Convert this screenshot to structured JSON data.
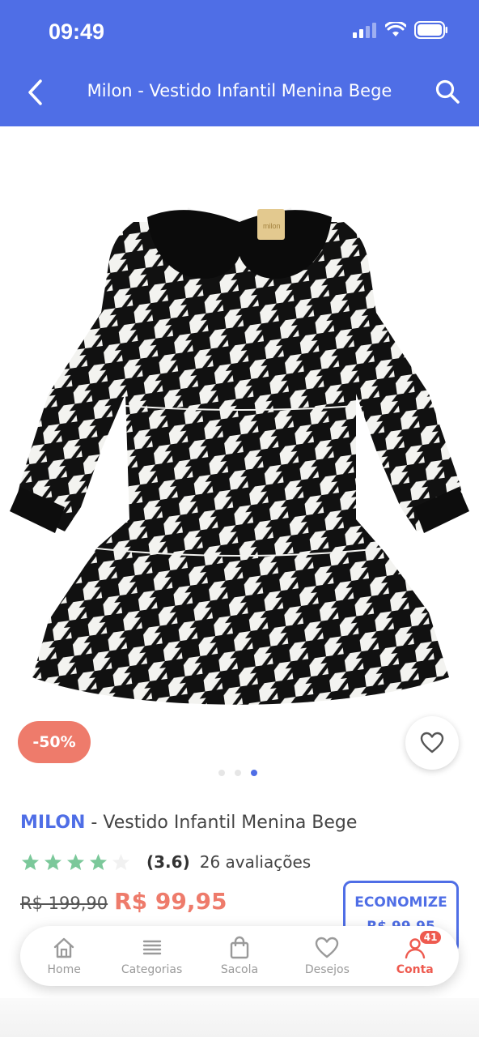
{
  "status": {
    "time": "09:49"
  },
  "header": {
    "title": "Milon - Vestido Infantil Menina Bege"
  },
  "product": {
    "discount": "-50%",
    "brand": "MILON",
    "name_suffix": " - Vestido Infantil Menina Bege",
    "rating_value": "(3.6)",
    "rating_count": "26 avaliações",
    "rating_stars": 3.6,
    "old_price": "R$ 199,90",
    "new_price": "R$ 99,95",
    "economize_label": "ECONOMIZE",
    "economize_value": "R$ 99,95",
    "image_pager": {
      "total": 3,
      "active": 3
    }
  },
  "bottom_nav": {
    "items": [
      {
        "label": "Home",
        "icon": "home-icon"
      },
      {
        "label": "Categorias",
        "icon": "list-icon"
      },
      {
        "label": "Sacola",
        "icon": "bag-icon"
      },
      {
        "label": "Desejos",
        "icon": "heart-icon"
      },
      {
        "label": "Conta",
        "icon": "user-icon",
        "badge": "41",
        "active": true
      }
    ]
  },
  "colors": {
    "primary": "#4f6ee6",
    "accent": "#ee7b6b",
    "star": "#7bc89a"
  }
}
